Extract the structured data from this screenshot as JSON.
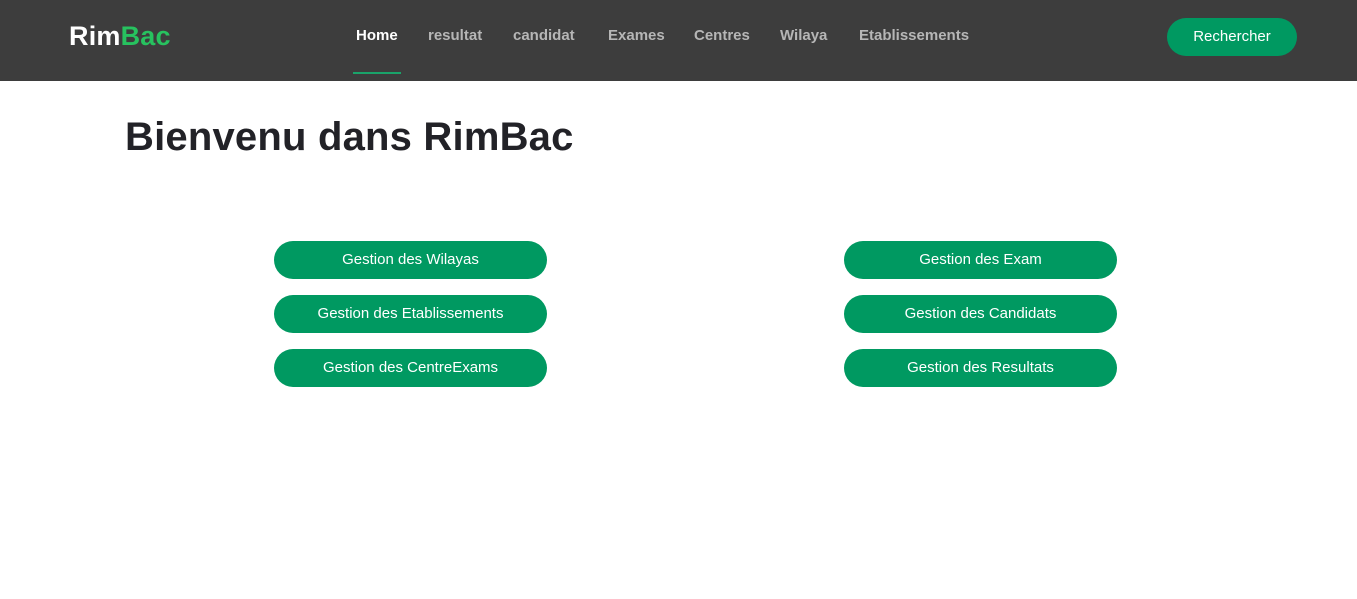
{
  "brand": {
    "part1": "Rim",
    "part2": "Bac"
  },
  "nav": {
    "items": [
      {
        "label": "Home",
        "active": true
      },
      {
        "label": "resultat",
        "active": false
      },
      {
        "label": "candidat",
        "active": false
      },
      {
        "label": "Exames",
        "active": false
      },
      {
        "label": "Centres",
        "active": false
      },
      {
        "label": "Wilaya",
        "active": false
      },
      {
        "label": "Etablissements",
        "active": false
      }
    ]
  },
  "header": {
    "search_button_label": "Rechercher"
  },
  "main": {
    "title": "Bienvenu dans RimBac",
    "left_buttons": [
      {
        "label": "Gestion des Wilayas"
      },
      {
        "label": "Gestion des Etablissements"
      },
      {
        "label": "Gestion des CentreExams"
      }
    ],
    "right_buttons": [
      {
        "label": "Gestion des Exam"
      },
      {
        "label": "Gestion des Candidats"
      },
      {
        "label": "Gestion des Resultats"
      }
    ]
  },
  "colors": {
    "header_bg": "#3d3d3d",
    "accent": "#009961",
    "brand_green": "#27c25f"
  }
}
